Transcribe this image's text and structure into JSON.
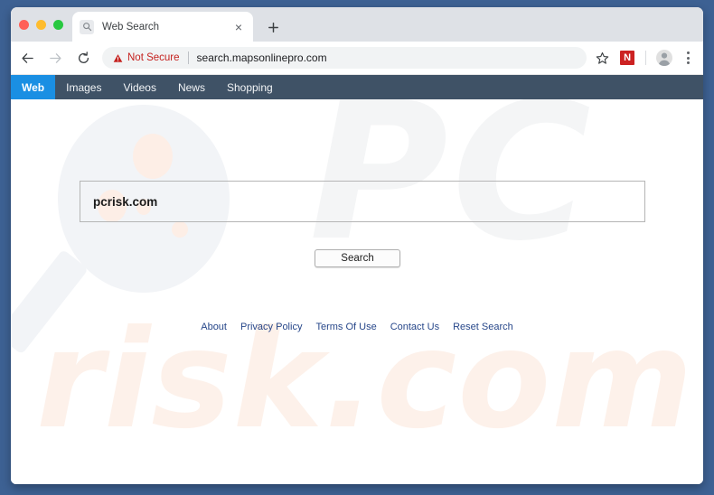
{
  "browser": {
    "traffic_lights": [
      "close",
      "minimize",
      "maximize"
    ],
    "tab": {
      "favicon": "search-icon",
      "title": "Web Search",
      "close_label": "×"
    },
    "new_tab_label": "+",
    "toolbar": {
      "back_label": "←",
      "forward_label": "→",
      "reload_label": "↻",
      "security_label": "Not Secure",
      "url": "search.mapsonlinepro.com",
      "bookmark_icon": "star-icon",
      "extension_badge": "N",
      "profile_icon": "avatar-icon",
      "menu_icon": "three-dot-menu-icon"
    }
  },
  "site_nav": {
    "items": [
      {
        "label": "Web",
        "active": true
      },
      {
        "label": "Images",
        "active": false
      },
      {
        "label": "Videos",
        "active": false
      },
      {
        "label": "News",
        "active": false
      },
      {
        "label": "Shopping",
        "active": false
      }
    ]
  },
  "search": {
    "query": "pcrisk.com",
    "placeholder": "",
    "submit_label": "Search"
  },
  "watermarks": {
    "top": "PC",
    "bottom": "risk.com"
  },
  "footer": {
    "links": [
      "About",
      "Privacy Policy",
      "Terms Of Use",
      "Contact Us",
      "Reset Search"
    ]
  },
  "colors": {
    "desktop_background": "#3d6193",
    "tab_strip": "#dee1e6",
    "site_nav_background": "#3f5266",
    "site_nav_active": "#1a8fe3",
    "not_secure": "#c5221f",
    "extension_badge": "#cc2222",
    "footer_link": "#27478a",
    "watermark_top": "#f4f5f6",
    "watermark_bottom": "#fdf1ea"
  }
}
